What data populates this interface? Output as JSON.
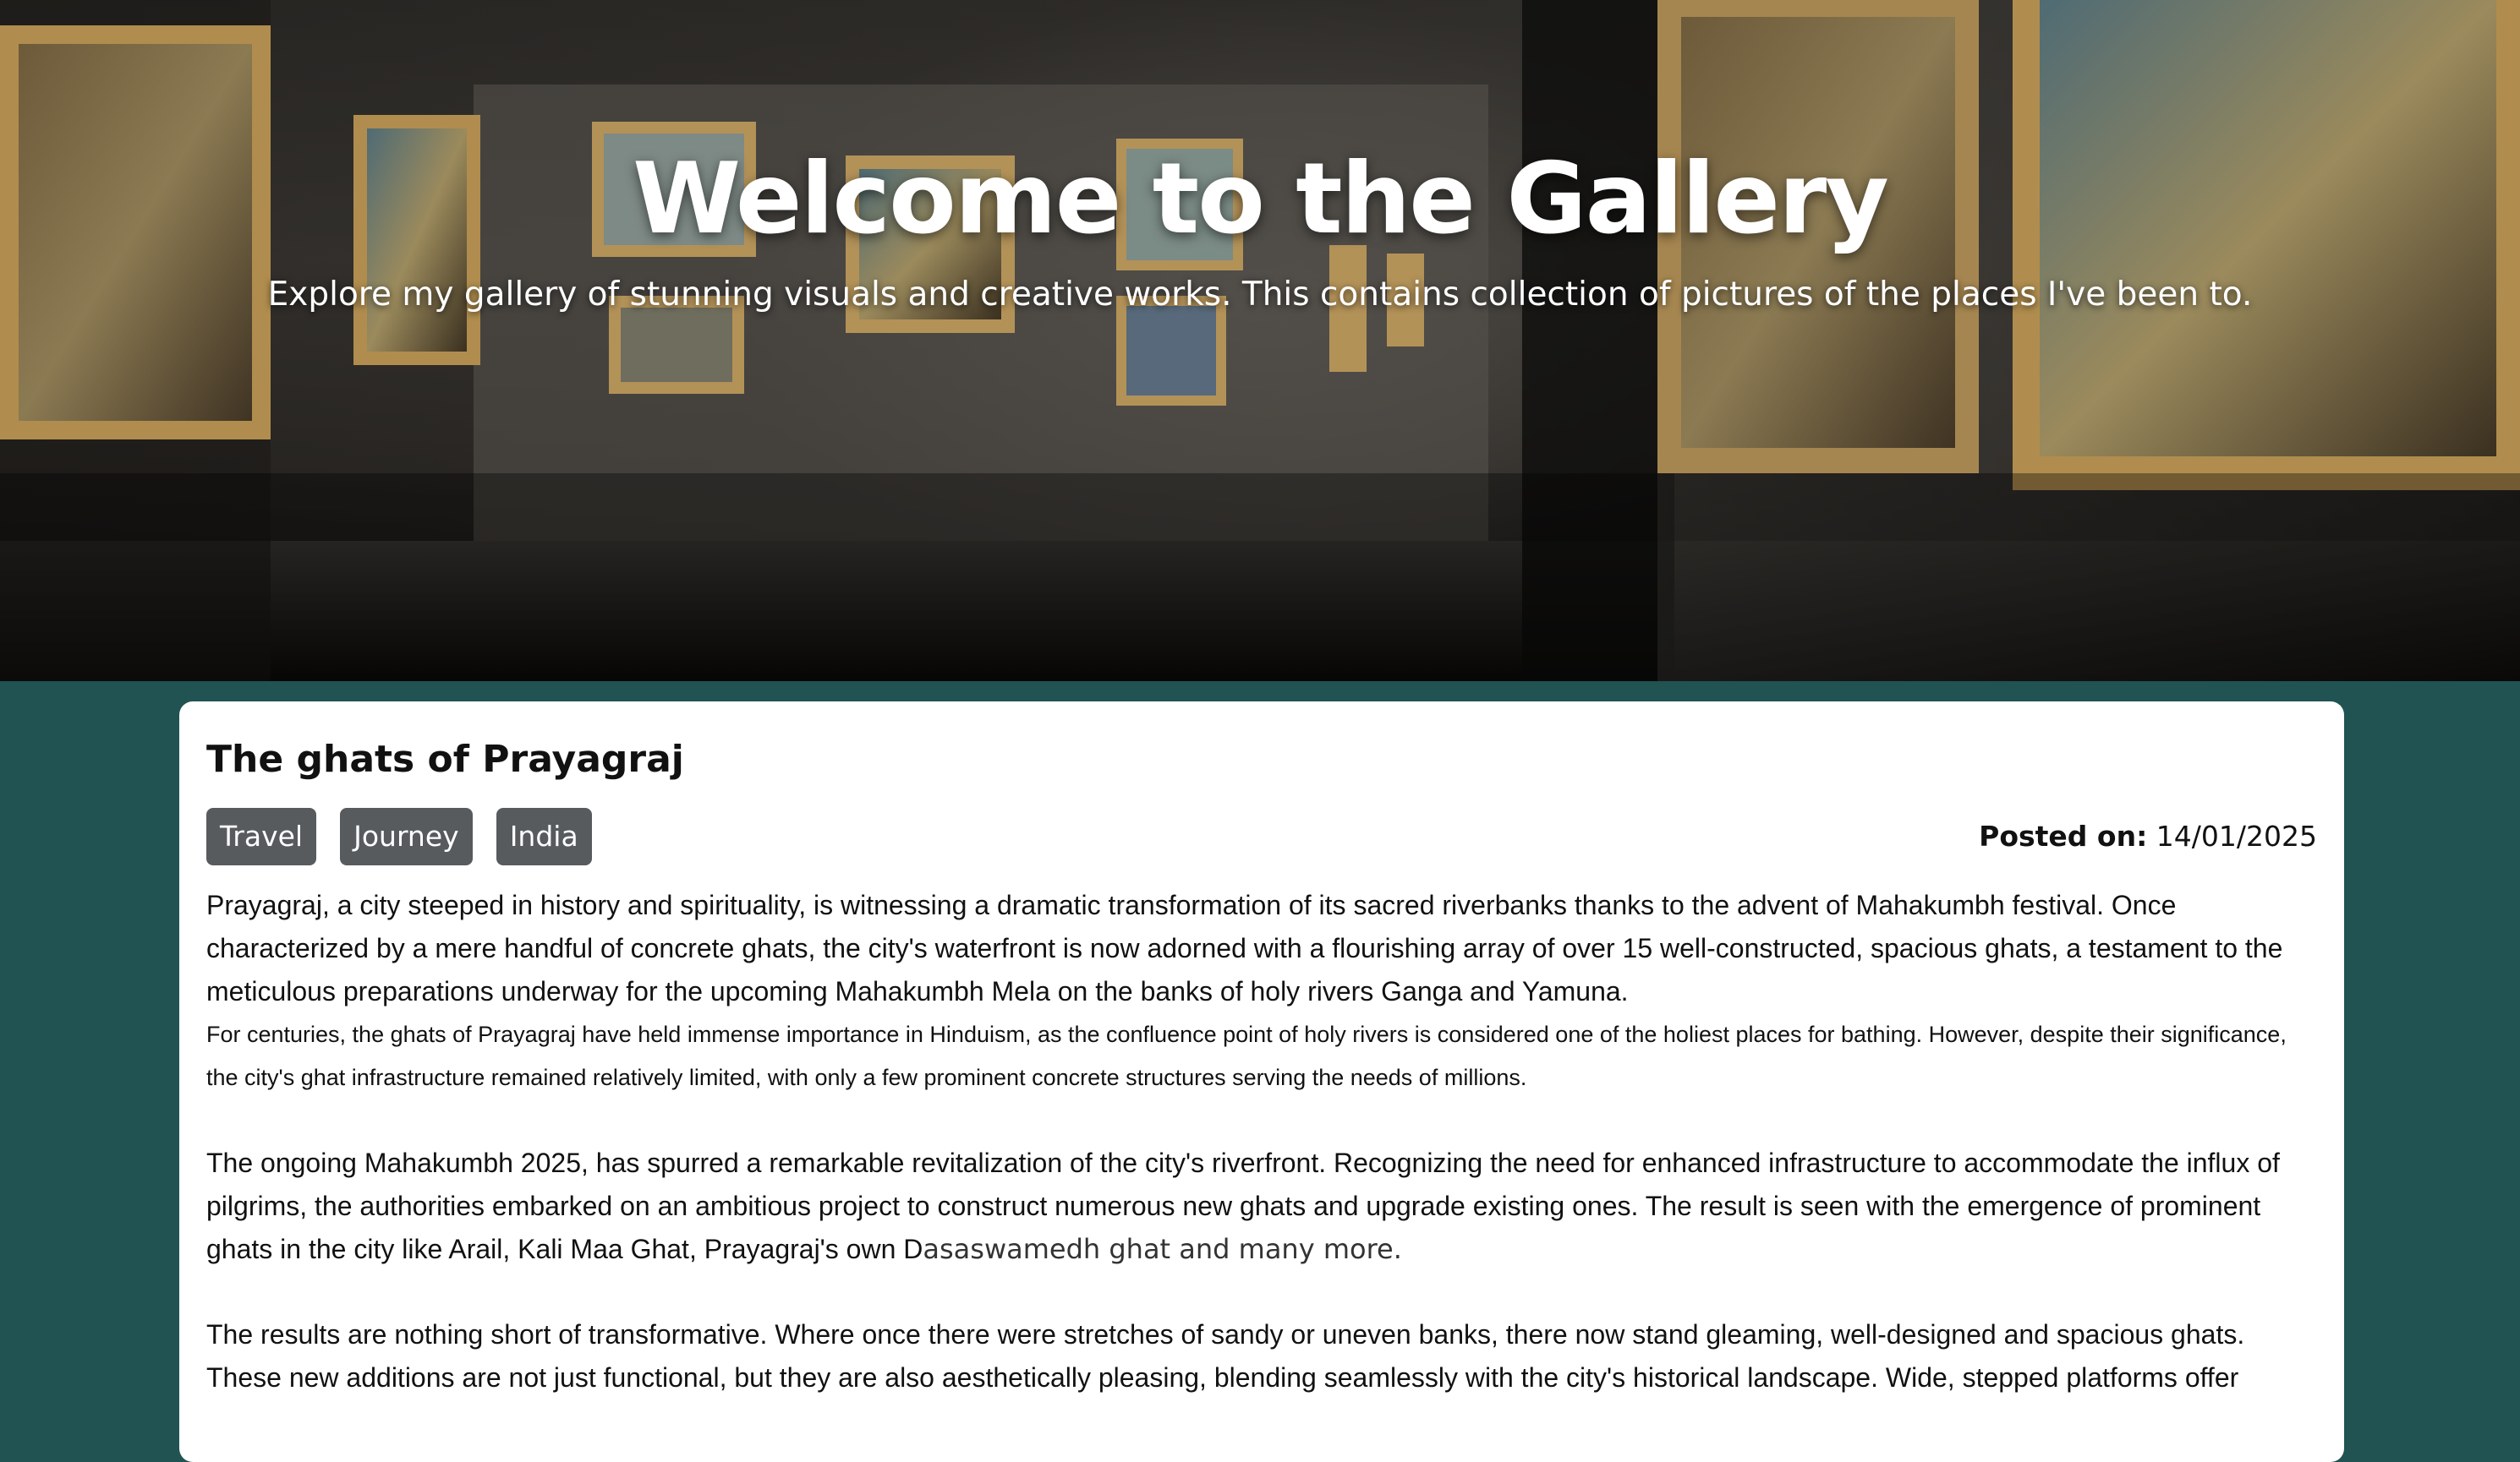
{
  "hero": {
    "title": "Welcome to the Gallery",
    "subtitle": "Explore my gallery of stunning visuals and creative works. This contains collection of pictures of the places I've been to."
  },
  "post": {
    "title": "The ghats of Prayagraj",
    "tags": [
      "Travel",
      "Journey",
      "India"
    ],
    "posted_label": "Posted on:",
    "posted_date": "14/01/2025",
    "paragraphs": [
      "Prayagraj, a city steeped in history and spirituality, is witnessing a dramatic transformation of its sacred riverbanks thanks to the advent of Mahakumbh festival. Once characterized by a mere handful of concrete ghats, the city's waterfront is now adorned with a flourishing array of over 15 well-constructed, spacious ghats, a testament to the meticulous preparations underway for the upcoming Mahakumbh Mela on the banks of holy rivers Ganga and Yamuna.",
      "For centuries, the ghats of Prayagraj have held immense importance in Hinduism, as the confluence point of holy rivers is considered one of the holiest places for bathing. However, despite their significance, the city's ghat infrastructure remained relatively limited, with only a few prominent concrete structures serving the needs of millions.",
      "The ongoing Mahakumbh 2025, has spurred a remarkable revitalization of the city's riverfront. Recognizing the need for enhanced infrastructure to accommodate the influx of pilgrims, the authorities embarked on an ambitious project to construct numerous new ghats and upgrade existing ones. The result is seen with the emergence of prominent ghats in the city like Arail, Kali Maa Ghat, Prayagraj's own D",
      "asaswamedh ghat and many more.",
      "The results are nothing short of transformative. Where once there were stretches of sandy or uneven banks, there now stand gleaming, well-designed and spacious ghats. These new additions are not just functional, but they are also aesthetically pleasing, blending seamlessly with the city's historical landscape. Wide, stepped platforms offer"
    ]
  },
  "colors": {
    "page_background": "#205352",
    "card_background": "#ffffff",
    "tag_background": "#575b5e"
  }
}
